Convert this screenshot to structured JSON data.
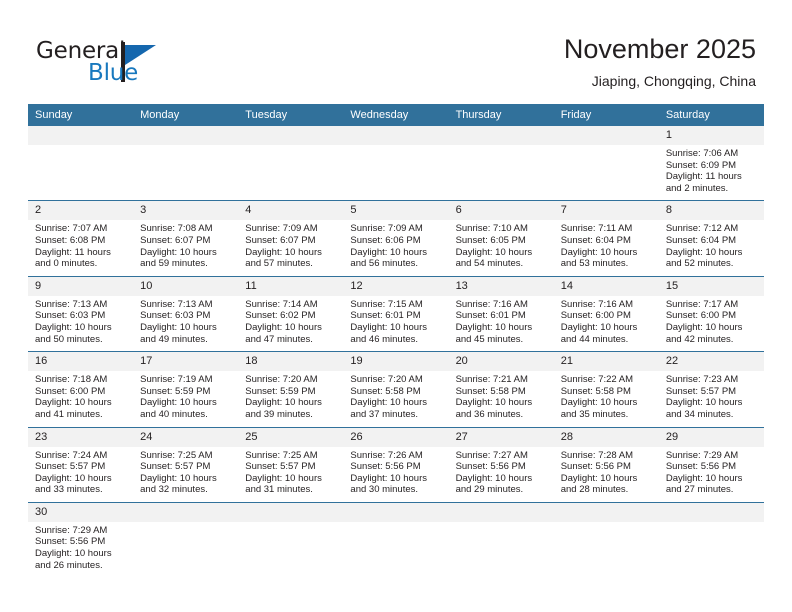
{
  "brand": {
    "name_part1": "General",
    "name_part2": "Blue",
    "flag_icon": "triangle-flag-icon",
    "accent_color": "#1878be"
  },
  "header": {
    "title": "November 2025",
    "subtitle": "Jiaping, Chongqing, China"
  },
  "calendar": {
    "header_color": "#31719b",
    "daynum_band_color": "#f2f2f2",
    "weekdays": [
      "Sunday",
      "Monday",
      "Tuesday",
      "Wednesday",
      "Thursday",
      "Friday",
      "Saturday"
    ],
    "weeks": [
      [
        {
          "day": "",
          "sunrise": "",
          "sunset": "",
          "daylight1": "",
          "daylight2": ""
        },
        {
          "day": "",
          "sunrise": "",
          "sunset": "",
          "daylight1": "",
          "daylight2": ""
        },
        {
          "day": "",
          "sunrise": "",
          "sunset": "",
          "daylight1": "",
          "daylight2": ""
        },
        {
          "day": "",
          "sunrise": "",
          "sunset": "",
          "daylight1": "",
          "daylight2": ""
        },
        {
          "day": "",
          "sunrise": "",
          "sunset": "",
          "daylight1": "",
          "daylight2": ""
        },
        {
          "day": "",
          "sunrise": "",
          "sunset": "",
          "daylight1": "",
          "daylight2": ""
        },
        {
          "day": "1",
          "sunrise": "Sunrise: 7:06 AM",
          "sunset": "Sunset: 6:09 PM",
          "daylight1": "Daylight: 11 hours",
          "daylight2": "and 2 minutes."
        }
      ],
      [
        {
          "day": "2",
          "sunrise": "Sunrise: 7:07 AM",
          "sunset": "Sunset: 6:08 PM",
          "daylight1": "Daylight: 11 hours",
          "daylight2": "and 0 minutes."
        },
        {
          "day": "3",
          "sunrise": "Sunrise: 7:08 AM",
          "sunset": "Sunset: 6:07 PM",
          "daylight1": "Daylight: 10 hours",
          "daylight2": "and 59 minutes."
        },
        {
          "day": "4",
          "sunrise": "Sunrise: 7:09 AM",
          "sunset": "Sunset: 6:07 PM",
          "daylight1": "Daylight: 10 hours",
          "daylight2": "and 57 minutes."
        },
        {
          "day": "5",
          "sunrise": "Sunrise: 7:09 AM",
          "sunset": "Sunset: 6:06 PM",
          "daylight1": "Daylight: 10 hours",
          "daylight2": "and 56 minutes."
        },
        {
          "day": "6",
          "sunrise": "Sunrise: 7:10 AM",
          "sunset": "Sunset: 6:05 PM",
          "daylight1": "Daylight: 10 hours",
          "daylight2": "and 54 minutes."
        },
        {
          "day": "7",
          "sunrise": "Sunrise: 7:11 AM",
          "sunset": "Sunset: 6:04 PM",
          "daylight1": "Daylight: 10 hours",
          "daylight2": "and 53 minutes."
        },
        {
          "day": "8",
          "sunrise": "Sunrise: 7:12 AM",
          "sunset": "Sunset: 6:04 PM",
          "daylight1": "Daylight: 10 hours",
          "daylight2": "and 52 minutes."
        }
      ],
      [
        {
          "day": "9",
          "sunrise": "Sunrise: 7:13 AM",
          "sunset": "Sunset: 6:03 PM",
          "daylight1": "Daylight: 10 hours",
          "daylight2": "and 50 minutes."
        },
        {
          "day": "10",
          "sunrise": "Sunrise: 7:13 AM",
          "sunset": "Sunset: 6:03 PM",
          "daylight1": "Daylight: 10 hours",
          "daylight2": "and 49 minutes."
        },
        {
          "day": "11",
          "sunrise": "Sunrise: 7:14 AM",
          "sunset": "Sunset: 6:02 PM",
          "daylight1": "Daylight: 10 hours",
          "daylight2": "and 47 minutes."
        },
        {
          "day": "12",
          "sunrise": "Sunrise: 7:15 AM",
          "sunset": "Sunset: 6:01 PM",
          "daylight1": "Daylight: 10 hours",
          "daylight2": "and 46 minutes."
        },
        {
          "day": "13",
          "sunrise": "Sunrise: 7:16 AM",
          "sunset": "Sunset: 6:01 PM",
          "daylight1": "Daylight: 10 hours",
          "daylight2": "and 45 minutes."
        },
        {
          "day": "14",
          "sunrise": "Sunrise: 7:16 AM",
          "sunset": "Sunset: 6:00 PM",
          "daylight1": "Daylight: 10 hours",
          "daylight2": "and 44 minutes."
        },
        {
          "day": "15",
          "sunrise": "Sunrise: 7:17 AM",
          "sunset": "Sunset: 6:00 PM",
          "daylight1": "Daylight: 10 hours",
          "daylight2": "and 42 minutes."
        }
      ],
      [
        {
          "day": "16",
          "sunrise": "Sunrise: 7:18 AM",
          "sunset": "Sunset: 6:00 PM",
          "daylight1": "Daylight: 10 hours",
          "daylight2": "and 41 minutes."
        },
        {
          "day": "17",
          "sunrise": "Sunrise: 7:19 AM",
          "sunset": "Sunset: 5:59 PM",
          "daylight1": "Daylight: 10 hours",
          "daylight2": "and 40 minutes."
        },
        {
          "day": "18",
          "sunrise": "Sunrise: 7:20 AM",
          "sunset": "Sunset: 5:59 PM",
          "daylight1": "Daylight: 10 hours",
          "daylight2": "and 39 minutes."
        },
        {
          "day": "19",
          "sunrise": "Sunrise: 7:20 AM",
          "sunset": "Sunset: 5:58 PM",
          "daylight1": "Daylight: 10 hours",
          "daylight2": "and 37 minutes."
        },
        {
          "day": "20",
          "sunrise": "Sunrise: 7:21 AM",
          "sunset": "Sunset: 5:58 PM",
          "daylight1": "Daylight: 10 hours",
          "daylight2": "and 36 minutes."
        },
        {
          "day": "21",
          "sunrise": "Sunrise: 7:22 AM",
          "sunset": "Sunset: 5:58 PM",
          "daylight1": "Daylight: 10 hours",
          "daylight2": "and 35 minutes."
        },
        {
          "day": "22",
          "sunrise": "Sunrise: 7:23 AM",
          "sunset": "Sunset: 5:57 PM",
          "daylight1": "Daylight: 10 hours",
          "daylight2": "and 34 minutes."
        }
      ],
      [
        {
          "day": "23",
          "sunrise": "Sunrise: 7:24 AM",
          "sunset": "Sunset: 5:57 PM",
          "daylight1": "Daylight: 10 hours",
          "daylight2": "and 33 minutes."
        },
        {
          "day": "24",
          "sunrise": "Sunrise: 7:25 AM",
          "sunset": "Sunset: 5:57 PM",
          "daylight1": "Daylight: 10 hours",
          "daylight2": "and 32 minutes."
        },
        {
          "day": "25",
          "sunrise": "Sunrise: 7:25 AM",
          "sunset": "Sunset: 5:57 PM",
          "daylight1": "Daylight: 10 hours",
          "daylight2": "and 31 minutes."
        },
        {
          "day": "26",
          "sunrise": "Sunrise: 7:26 AM",
          "sunset": "Sunset: 5:56 PM",
          "daylight1": "Daylight: 10 hours",
          "daylight2": "and 30 minutes."
        },
        {
          "day": "27",
          "sunrise": "Sunrise: 7:27 AM",
          "sunset": "Sunset: 5:56 PM",
          "daylight1": "Daylight: 10 hours",
          "daylight2": "and 29 minutes."
        },
        {
          "day": "28",
          "sunrise": "Sunrise: 7:28 AM",
          "sunset": "Sunset: 5:56 PM",
          "daylight1": "Daylight: 10 hours",
          "daylight2": "and 28 minutes."
        },
        {
          "day": "29",
          "sunrise": "Sunrise: 7:29 AM",
          "sunset": "Sunset: 5:56 PM",
          "daylight1": "Daylight: 10 hours",
          "daylight2": "and 27 minutes."
        }
      ],
      [
        {
          "day": "30",
          "sunrise": "Sunrise: 7:29 AM",
          "sunset": "Sunset: 5:56 PM",
          "daylight1": "Daylight: 10 hours",
          "daylight2": "and 26 minutes."
        },
        {
          "day": "",
          "sunrise": "",
          "sunset": "",
          "daylight1": "",
          "daylight2": ""
        },
        {
          "day": "",
          "sunrise": "",
          "sunset": "",
          "daylight1": "",
          "daylight2": ""
        },
        {
          "day": "",
          "sunrise": "",
          "sunset": "",
          "daylight1": "",
          "daylight2": ""
        },
        {
          "day": "",
          "sunrise": "",
          "sunset": "",
          "daylight1": "",
          "daylight2": ""
        },
        {
          "day": "",
          "sunrise": "",
          "sunset": "",
          "daylight1": "",
          "daylight2": ""
        },
        {
          "day": "",
          "sunrise": "",
          "sunset": "",
          "daylight1": "",
          "daylight2": ""
        }
      ]
    ]
  }
}
